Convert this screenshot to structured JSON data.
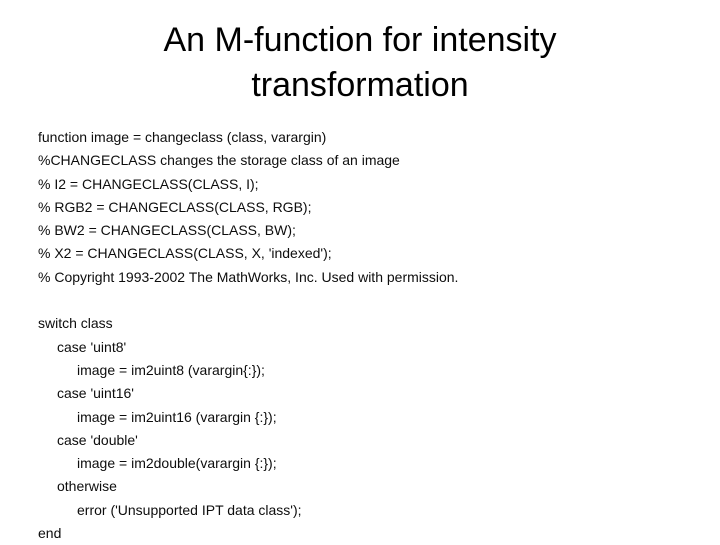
{
  "slide": {
    "title_lines": [
      "An M-function for intensity",
      "transformation"
    ],
    "header_block": [
      {
        "indent": 0,
        "text": "function image = changeclass (class, varargin)"
      },
      {
        "indent": 0,
        "text": "%CHANGECLASS changes the storage class of an image"
      },
      {
        "indent": 0,
        "text": "% I2 = CHANGECLASS(CLASS, I);"
      },
      {
        "indent": 0,
        "text": "% RGB2 = CHANGECLASS(CLASS, RGB);"
      },
      {
        "indent": 0,
        "text": "% BW2 = CHANGECLASS(CLASS, BW);"
      },
      {
        "indent": 0,
        "text": "% X2 = CHANGECLASS(CLASS, X, 'indexed');"
      },
      {
        "indent": 0,
        "text": "% Copyright 1993-2002 The MathWorks, Inc. Used with permission."
      }
    ],
    "switch_block": [
      {
        "indent": 0,
        "text": "switch class"
      },
      {
        "indent": 1,
        "text": "case 'uint8'"
      },
      {
        "indent": 2,
        "text": "image = im2uint8 (varargin{:});"
      },
      {
        "indent": 1,
        "text": "case 'uint16'"
      },
      {
        "indent": 2,
        "text": "image = im2uint16 (varargin {:});"
      },
      {
        "indent": 1,
        "text": "case 'double'"
      },
      {
        "indent": 2,
        "text": "image = im2double(varargin {:});"
      },
      {
        "indent": 1,
        "text": "otherwise"
      },
      {
        "indent": 2,
        "text": "error ('Unsupported IPT data class');"
      },
      {
        "indent": 0,
        "text": "end"
      }
    ],
    "colors": {
      "background": "#ffffff",
      "title_text": "#000000",
      "code_text": "#0d0d0d"
    }
  }
}
